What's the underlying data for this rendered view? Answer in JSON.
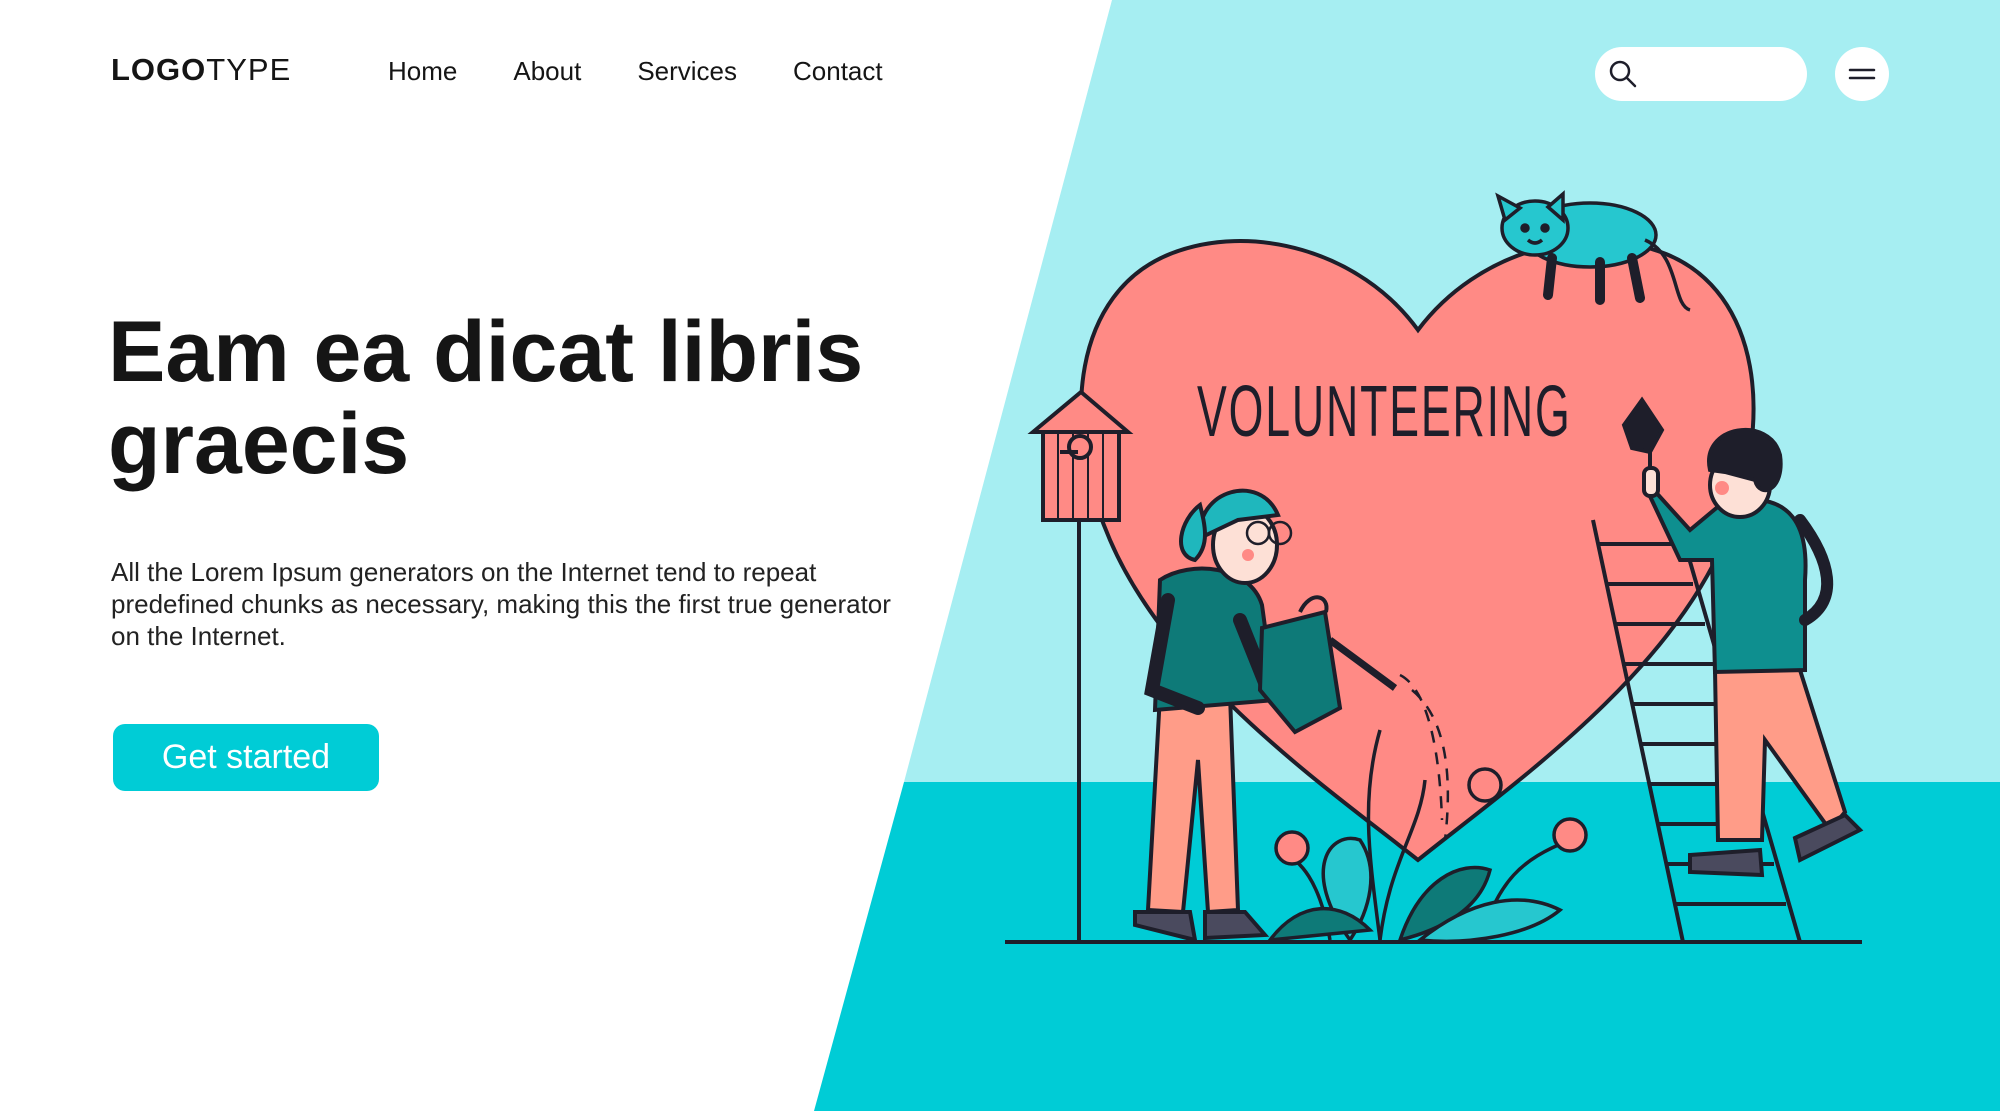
{
  "header": {
    "logo_bold": "LOGO",
    "logo_light": "TYPE",
    "nav": [
      "Home",
      "About",
      "Services",
      "Contact"
    ],
    "search_placeholder": ""
  },
  "hero": {
    "title": "Eam ea dicat libris graecis",
    "description": "All the Lorem Ipsum generators on the Internet tend to repeat predefined chunks as necessary, making this the first true generator on the Internet.",
    "cta_label": "Get started"
  },
  "illustration": {
    "heart_text": "VOLUNTEERING"
  },
  "colors": {
    "accent": "#00ccd6",
    "sky": "#a6eef2",
    "ground": "#00ccd6",
    "heart": "#ff8a85",
    "dark_teal": "#0e7a78",
    "text": "#151515"
  },
  "icons": [
    "search-icon",
    "menu-icon",
    "cat-icon",
    "birdhouse-icon",
    "watering-can-icon",
    "ladder-icon",
    "plant-icon"
  ]
}
